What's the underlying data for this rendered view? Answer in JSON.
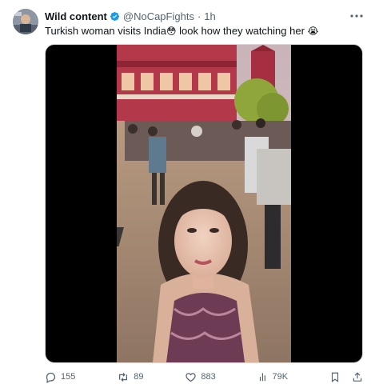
{
  "tweet": {
    "display_name": "Wild content",
    "handle": "@NoCapFights",
    "separator": "·",
    "time": "1h",
    "text_before": "Turkish woman visits India",
    "emoji_flushed": "😳",
    "text_after": " look how they watching her ",
    "emoji_crying": "😭"
  },
  "icons": {
    "verified": "verified-badge-icon",
    "more": "more-options-icon",
    "reply": "reply-icon",
    "retweet": "retweet-icon",
    "like": "like-icon",
    "views": "views-icon",
    "bookmark": "bookmark-icon",
    "share": "share-icon"
  },
  "actions": {
    "replies": "155",
    "retweets": "89",
    "likes": "883",
    "views": "79K"
  },
  "colors": {
    "verified": "#1d9bf0",
    "muted": "#536471",
    "text": "#0f1419"
  }
}
